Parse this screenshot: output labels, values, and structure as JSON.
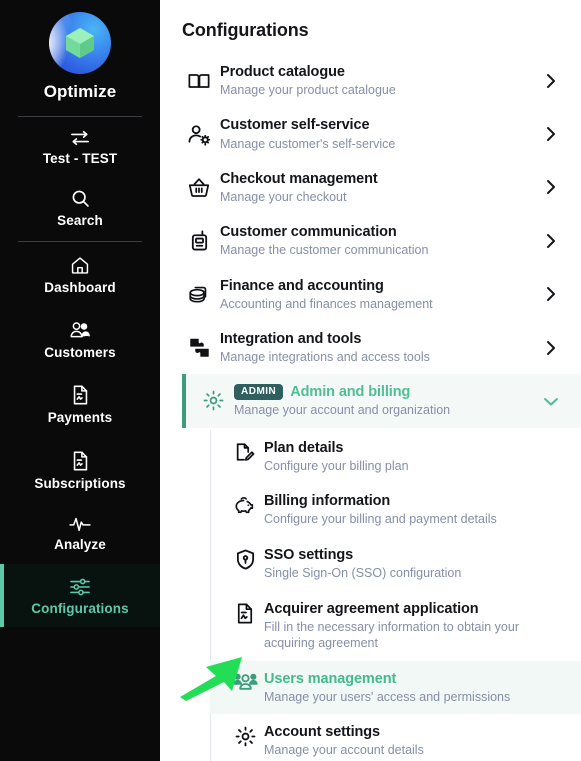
{
  "sidebar": {
    "brand": {
      "name": "Optimize",
      "logo_icon": "optimize-logo"
    },
    "switcher": {
      "label": "Test - TEST",
      "icon": "swap-arrows-icon"
    },
    "search": {
      "label": "Search",
      "icon": "search-icon"
    },
    "items": [
      {
        "label": "Dashboard",
        "icon": "home-icon",
        "active": false
      },
      {
        "label": "Customers",
        "icon": "users-icon",
        "active": false
      },
      {
        "label": "Payments",
        "icon": "document-icon",
        "active": false
      },
      {
        "label": "Subscriptions",
        "icon": "document-icon",
        "active": false
      },
      {
        "label": "Analyze",
        "icon": "pulse-icon",
        "active": false
      },
      {
        "label": "Configurations",
        "icon": "sliders-icon",
        "active": true
      }
    ]
  },
  "main": {
    "title": "Configurations",
    "rows": [
      {
        "title": "Product catalogue",
        "subtitle": "Manage your product catalogue",
        "icon": "book-icon",
        "chevron": "chevron-right-icon"
      },
      {
        "title": "Customer self-service",
        "subtitle": "Manage customer's self-service",
        "icon": "user-gear-icon",
        "chevron": "chevron-right-icon"
      },
      {
        "title": "Checkout management",
        "subtitle": "Manage your checkout",
        "icon": "basket-icon",
        "chevron": "chevron-right-icon"
      },
      {
        "title": "Customer communication",
        "subtitle": "Manage the customer communication",
        "icon": "radio-icon",
        "chevron": "chevron-right-icon"
      },
      {
        "title": "Finance and accounting",
        "subtitle": "Accounting and finances management",
        "icon": "coins-icon",
        "chevron": "chevron-right-icon"
      },
      {
        "title": "Integration and tools",
        "subtitle": "Manage integrations and access tools",
        "icon": "puzzle-icon",
        "chevron": "chevron-right-icon"
      }
    ],
    "admin": {
      "badge": "ADMIN",
      "title": "Admin and billing",
      "subtitle": "Manage your account and organization",
      "icon": "gear-icon",
      "chevron": "chevron-down-icon",
      "expanded": true
    },
    "submenu": [
      {
        "title": "Plan details",
        "subtitle": "Configure your billing plan",
        "icon": "document-edit-icon",
        "selected": false
      },
      {
        "title": "Billing information",
        "subtitle": "Configure your billing and payment details",
        "icon": "piggy-bank-icon",
        "selected": false
      },
      {
        "title": "SSO settings",
        "subtitle": "Single Sign-On (SSO) configuration",
        "icon": "shield-key-icon",
        "selected": false
      },
      {
        "title": "Acquirer agreement application",
        "subtitle": "Fill in the necessary information to obtain your acquiring agreement",
        "icon": "document-signature-icon",
        "selected": false
      },
      {
        "title": "Users management",
        "subtitle": "Manage your users' access and permissions",
        "icon": "user-group-icon",
        "selected": true
      },
      {
        "title": "Account settings",
        "subtitle": "Manage your account details",
        "icon": "gear-icon",
        "selected": false
      }
    ]
  },
  "cursor": {
    "icon": "arrow-pointer",
    "color": "#22dd55"
  },
  "colors": {
    "sidebar_bg": "#0a0a0a",
    "accent_green": "#5ec9a8",
    "admin_green": "#4fbe93",
    "badge_bg": "#2f5f5e",
    "subtitle_gray": "#868fa8",
    "highlight_bg": "#f1f8f5"
  }
}
